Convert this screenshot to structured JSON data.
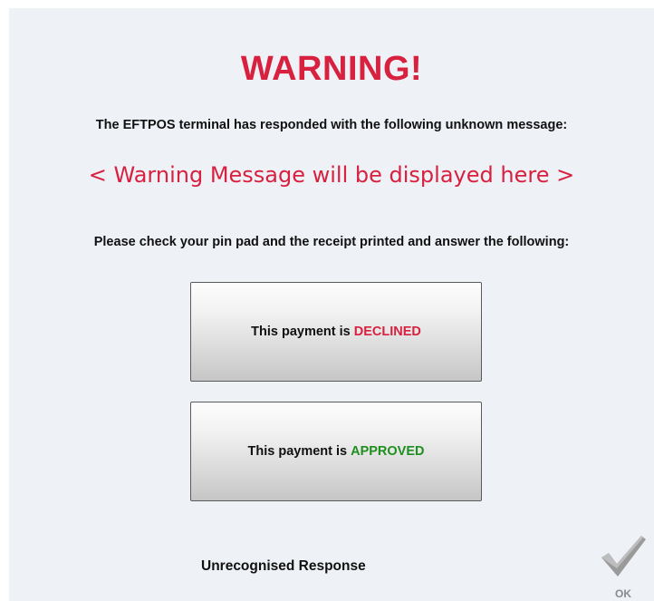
{
  "dialog": {
    "title": "WARNING!",
    "intro": "The EFTPOS terminal has responded with the following unknown message:",
    "message": "< Warning Message will be displayed here >",
    "instruction": "Please check your pin pad and the receipt printed and answer the following:"
  },
  "buttons": {
    "declined": {
      "prefix": "This payment is",
      "status": "DECLINED"
    },
    "approved": {
      "prefix": "This payment is",
      "status": "APPROVED"
    }
  },
  "footer": {
    "response_label": "Unrecognised Response",
    "ok_label": "OK",
    "ok_icon": "checkmark-icon"
  },
  "colors": {
    "warning_red": "#d8203f",
    "approved_green": "#1e8f1e",
    "panel_background": "#eef1f6"
  }
}
